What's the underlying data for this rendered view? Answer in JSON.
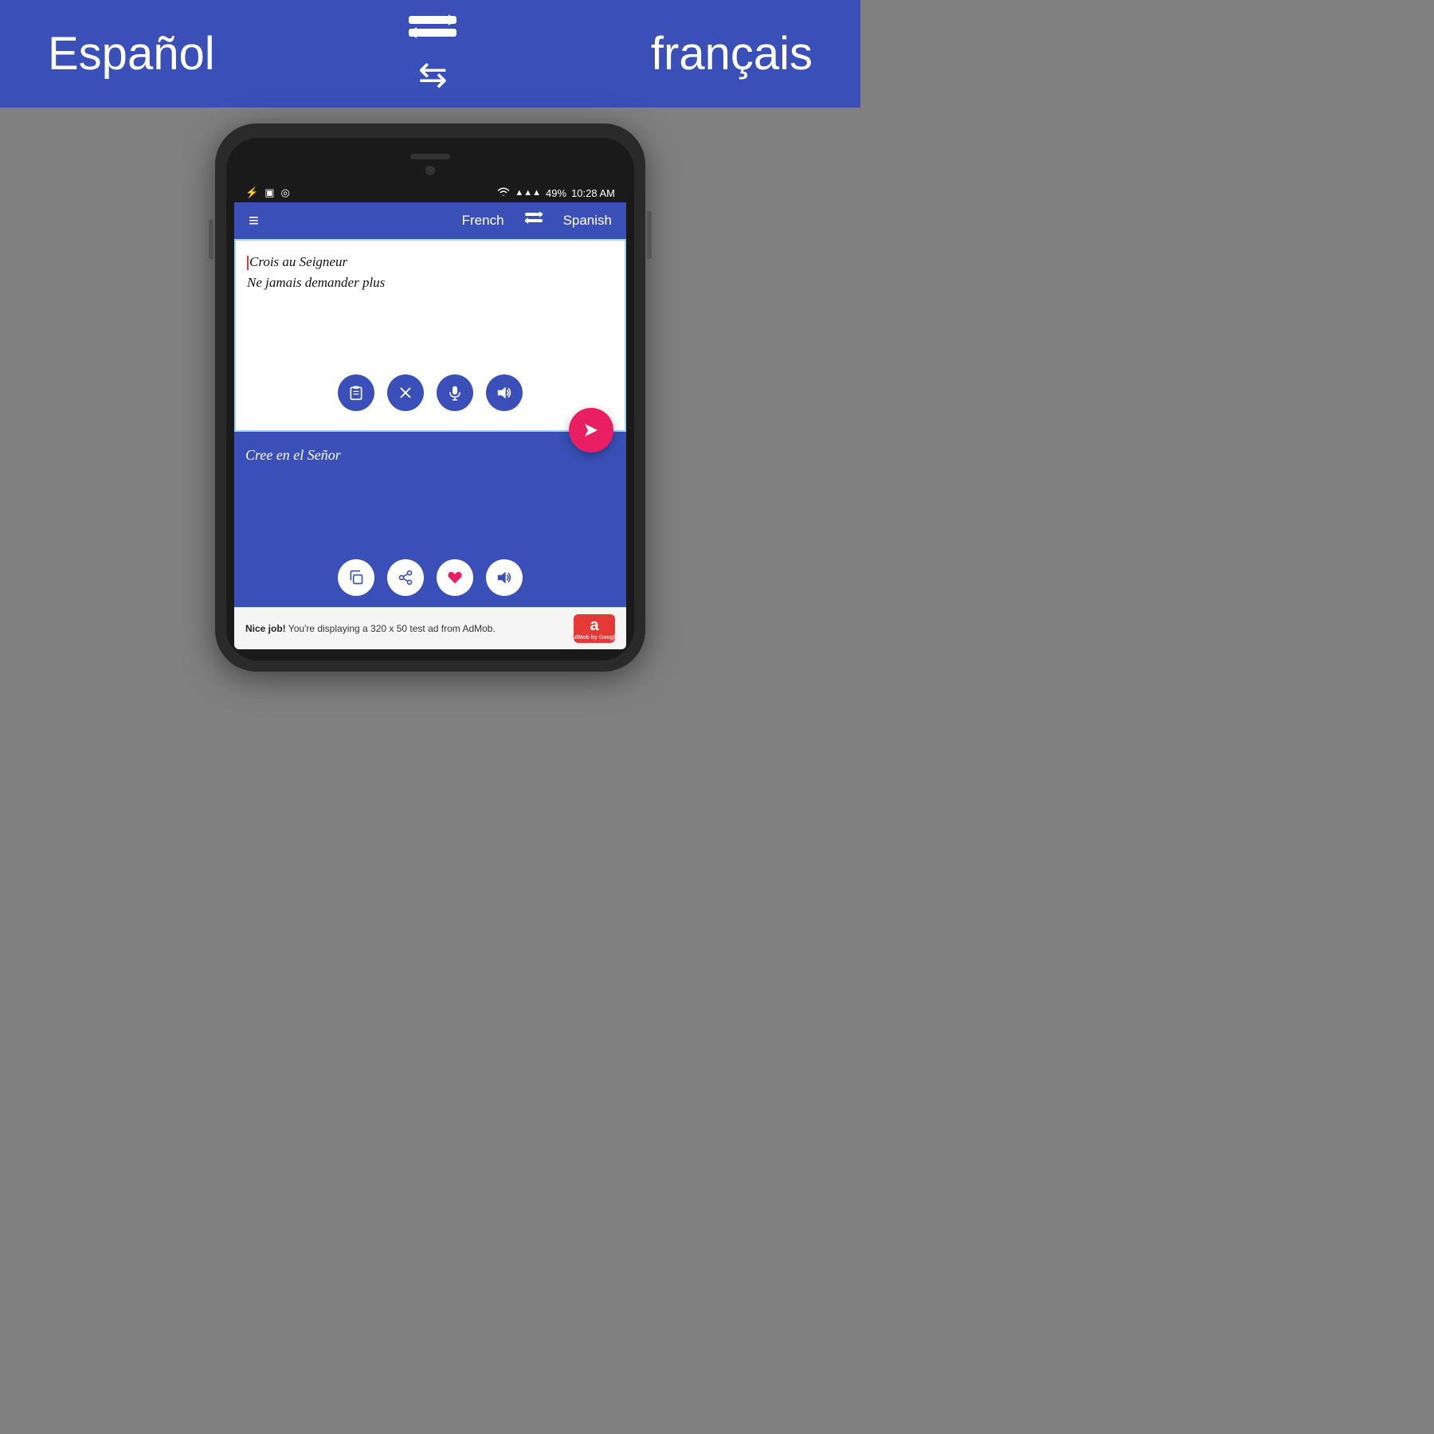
{
  "banner": {
    "lang_left": "Español",
    "lang_right": "français",
    "swap_icon": "⇄"
  },
  "status_bar": {
    "usb_icon": "ψ",
    "image_icon": "▣",
    "location_icon": "◎",
    "wifi_icon": "WiFi",
    "signal_icon": "▲▲▲",
    "battery": "49%",
    "time": "10:28 AM"
  },
  "app_header": {
    "hamburger": "≡",
    "lang_left": "French",
    "swap_icon": "⇄",
    "lang_right": "Spanish"
  },
  "input": {
    "line1": "Crois au Seigneur",
    "line2": "Ne jamais demander plus",
    "clipboard_btn": "📋",
    "clear_btn": "✕",
    "mic_btn": "🎤",
    "speaker_btn": "🔊"
  },
  "send": {
    "icon": "▶"
  },
  "output": {
    "text": "Cree en el Señor",
    "copy_btn": "⧉",
    "share_btn": "≪",
    "heart_btn": "♥",
    "speaker_btn": "🔊"
  },
  "ad": {
    "text_bold": "Nice job!",
    "text_normal": " You're displaying a 320 x 50 test ad from AdMob.",
    "logo_text": "a",
    "logo_sub": "AdMob by Google"
  }
}
